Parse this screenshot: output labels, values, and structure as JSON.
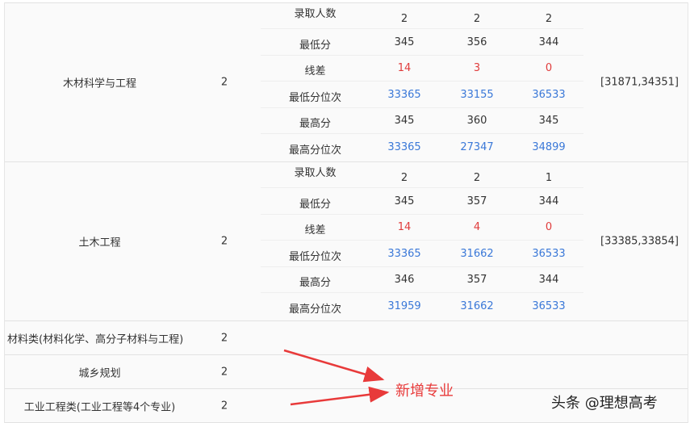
{
  "sub_labels": [
    "录取人数",
    "最低分",
    "线差",
    "最低分位次",
    "最高分",
    "最高分位次"
  ],
  "majors": [
    {
      "name": "木材科学与工程",
      "count": "2",
      "range": "[31871,34351]",
      "rows": [
        [
          "2",
          "2",
          "2"
        ],
        [
          "345",
          "356",
          "344"
        ],
        [
          "14",
          "3",
          "0"
        ],
        [
          "33365",
          "33155",
          "36533"
        ],
        [
          "345",
          "360",
          "345"
        ],
        [
          "33365",
          "27347",
          "34899"
        ]
      ]
    },
    {
      "name": "土木工程",
      "count": "2",
      "range": "[33385,33854]",
      "rows": [
        [
          "2",
          "2",
          "1"
        ],
        [
          "345",
          "357",
          "344"
        ],
        [
          "14",
          "4",
          "0"
        ],
        [
          "33365",
          "31662",
          "36533"
        ],
        [
          "346",
          "357",
          "344"
        ],
        [
          "31959",
          "31662",
          "36533"
        ]
      ]
    }
  ],
  "simple_rows": [
    {
      "name": "材料类(材料化学、高分子材料与工程)",
      "count": "2"
    },
    {
      "name": "城乡规划",
      "count": "2"
    },
    {
      "name": "工业工程类(工业工程等4个专业)",
      "count": "2"
    }
  ],
  "annotation": "新增专业",
  "watermark": "头条 @理想高考",
  "colors": {
    "diff": "#e03c3c",
    "rank": "#3a78d8",
    "annotation": "#e83a3a"
  }
}
